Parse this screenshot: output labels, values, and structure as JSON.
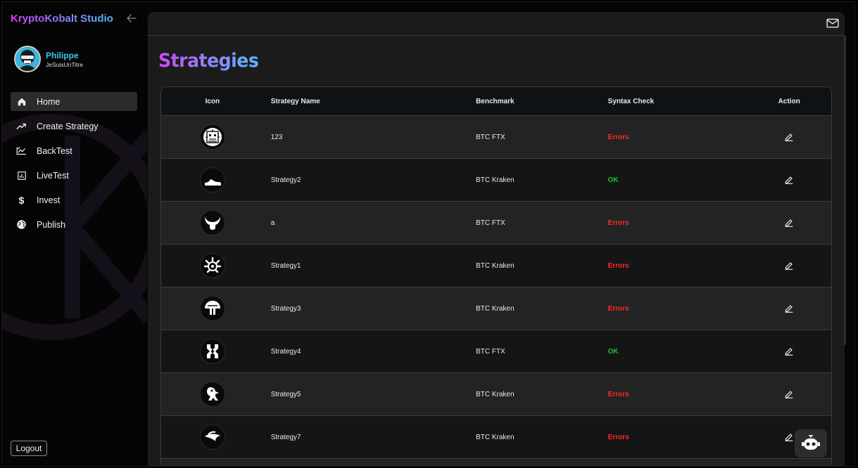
{
  "app": {
    "brand": "KryptoKobalt Studio"
  },
  "user": {
    "name": "Philippe",
    "handle": "JeSuisUnTitre"
  },
  "nav": [
    {
      "label": "Home",
      "icon": "home-icon",
      "active": true
    },
    {
      "label": "Create Strategy",
      "icon": "trending-up-icon"
    },
    {
      "label": "BackTest",
      "icon": "backtest-chart-icon"
    },
    {
      "label": "LiveTest",
      "icon": "bar-chart-icon"
    },
    {
      "label": "Invest",
      "icon": "dollar-icon"
    },
    {
      "label": "Publish",
      "icon": "globe-icon"
    }
  ],
  "logout_label": "Logout",
  "page_title": "Strategies",
  "table": {
    "headers": {
      "icon": "Icon",
      "name": "Strategy Name",
      "benchmark": "Benchmark",
      "syntax": "Syntax Check",
      "action": "Action"
    },
    "rows": [
      {
        "name": "123",
        "benchmark": "BTC FTX",
        "syntax": "Errors",
        "icon": "aztec-mask-icon"
      },
      {
        "name": "Strategy2",
        "benchmark": "BTC Kraken",
        "syntax": "OK",
        "icon": "sneaker-icon"
      },
      {
        "name": "a",
        "benchmark": "BTC FTX",
        "syntax": "Errors",
        "icon": "horned-skull-icon"
      },
      {
        "name": "Strategy1",
        "benchmark": "BTC Kraken",
        "syntax": "Errors",
        "icon": "sun-turtle-icon"
      },
      {
        "name": "Strategy3",
        "benchmark": "BTC Kraken",
        "syntax": "Errors",
        "icon": "mushroom-icon"
      },
      {
        "name": "Strategy4",
        "benchmark": "BTC FTX",
        "syntax": "OK",
        "icon": "tribal-glyph-icon"
      },
      {
        "name": "Strategy5",
        "benchmark": "BTC Kraken",
        "syntax": "Errors",
        "icon": "eagle-icon"
      },
      {
        "name": "Strategy7",
        "benchmark": "BTC Kraken",
        "syntax": "Errors",
        "icon": "fish-swoosh-icon"
      }
    ]
  },
  "colors": {
    "error": "#ff2a2a",
    "ok": "#1dbb2e",
    "accent_start": "#c64cf3",
    "accent_end": "#5ab6ff",
    "username": "#3dc7ee"
  }
}
